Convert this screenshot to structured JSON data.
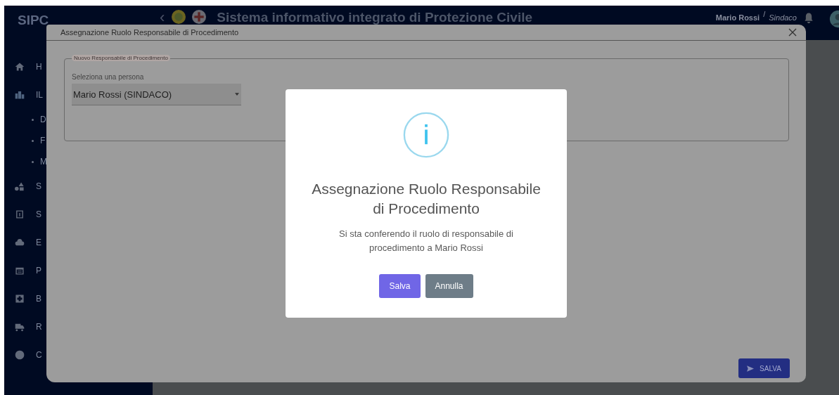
{
  "app_bar": {
    "brand": "SIPC",
    "back": "‹",
    "title": "Sistema informativo integrato di Protezione Civile",
    "user_name": "Mario Rossi",
    "separator": "/",
    "user_role": "Sindaco"
  },
  "sidebar": {
    "items": [
      {
        "label": "H",
        "kind": "main"
      },
      {
        "label": "IL",
        "kind": "main"
      },
      {
        "label": "D",
        "kind": "sub"
      },
      {
        "label": "F",
        "kind": "sub"
      },
      {
        "label": "M",
        "kind": "sub"
      },
      {
        "label": "S",
        "kind": "main"
      },
      {
        "label": "S",
        "kind": "main"
      },
      {
        "label": "E",
        "kind": "main"
      },
      {
        "label": "P",
        "kind": "main"
      },
      {
        "label": "B",
        "kind": "main"
      },
      {
        "label": "R",
        "kind": "main"
      },
      {
        "label": "C",
        "kind": "main"
      }
    ]
  },
  "dialog": {
    "title": "Assegnazione Ruolo Responsabile di Procedimento",
    "section": {
      "legend": "Nuovo Responsabile di Procedimento",
      "select": {
        "label": "Seleziona una persona",
        "value": "Mario Rossi (SINDACO)"
      }
    },
    "buttons": [
      {
        "label": "SALVA",
        "kind": "primary"
      }
    ]
  },
  "alert": {
    "title": "Assegnazione Ruolo Responsabile di Procedimento",
    "message": "Si sta conferendo il ruolo di responsabile di procedimento a Mario Rossi",
    "buttons": [
      {
        "label": "Salva",
        "kind": "confirm"
      },
      {
        "label": "Annulla",
        "kind": "cancel"
      }
    ]
  }
}
